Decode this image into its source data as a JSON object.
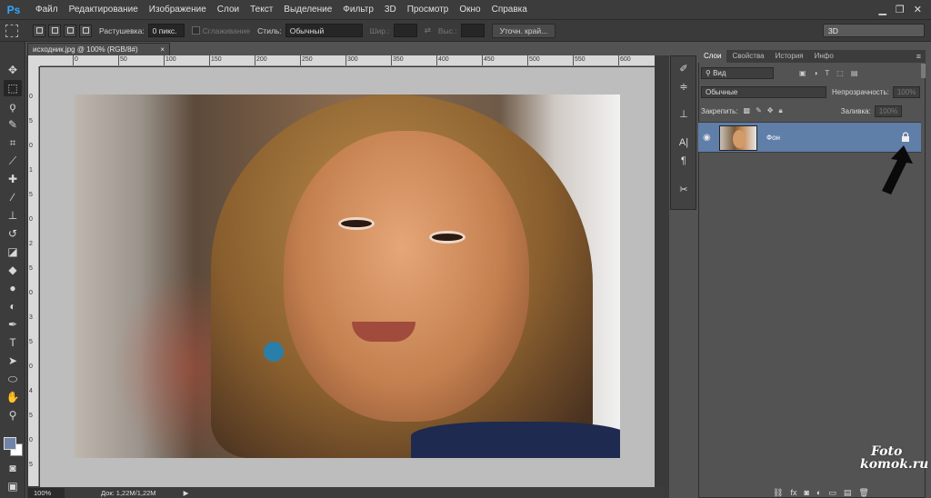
{
  "app": {
    "logo": "Ps"
  },
  "menu": [
    "Файл",
    "Редактирование",
    "Изображение",
    "Слои",
    "Текст",
    "Выделение",
    "Фильтр",
    "3D",
    "Просмотр",
    "Окно",
    "Справка"
  ],
  "window_controls": {
    "minimize": "▁",
    "restore": "❐",
    "close": "✕"
  },
  "options_bar": {
    "feather_label": "Растушевка:",
    "feather_value": "0 пикс.",
    "antialias_label": "Сглаживание",
    "style_label": "Стиль:",
    "style_value": "Обычный",
    "width_label": "Шир.:",
    "height_label": "Выс.:",
    "refine_edge_button": "Уточн. край...",
    "workspace": "3D"
  },
  "document": {
    "tab_title": "исходник.jpg @ 100% (RGB/8#)",
    "close": "×",
    "ruler_h": [
      "0",
      "50",
      "100",
      "150",
      "200",
      "250",
      "300",
      "350",
      "400",
      "450",
      "500",
      "550",
      "600",
      "650"
    ],
    "ruler_v": [
      "0",
      "5",
      "0",
      "1",
      "5",
      "0",
      "2",
      "5",
      "0",
      "3",
      "5",
      "0",
      "4",
      "5",
      "0",
      "5"
    ]
  },
  "status": {
    "zoom": "100%",
    "doc_size": "Док: 1,22M/1,22M"
  },
  "layers_panel": {
    "tabs": [
      "Слои",
      "Свойства",
      "История",
      "Инфо"
    ],
    "filter_label": "Вид",
    "blend_mode": "Обычные",
    "opacity_label": "Непрозрачность:",
    "opacity_value": "100%",
    "lock_label": "Закрепить:",
    "fill_label": "Заливка:",
    "fill_value": "100%",
    "layers": [
      {
        "name": "Фон",
        "locked": true,
        "visible": true
      }
    ]
  },
  "watermark": {
    "line1": "Foto",
    "line2": "komok.ru"
  },
  "colors": {
    "accent": "#31a8ff",
    "layer_selected": "#5f7ea8",
    "foreground": "#6f84a6",
    "background": "#ffffff"
  }
}
